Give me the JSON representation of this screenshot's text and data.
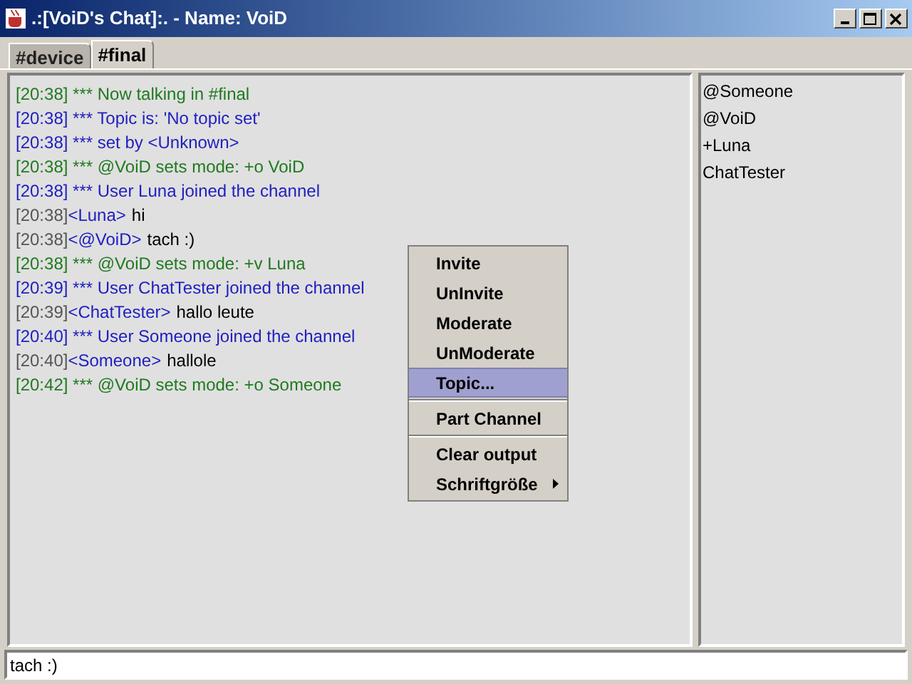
{
  "window": {
    "title": ".:[VoiD's Chat]:. - Name: VoiD"
  },
  "tabs": [
    {
      "label": "#device",
      "selected": false
    },
    {
      "label": "#final",
      "selected": true
    }
  ],
  "chat": {
    "lines": [
      {
        "kind": "status",
        "text": "[20:38] *** Now talking in #final"
      },
      {
        "kind": "info",
        "text": "[20:38] *** Topic is: 'No topic set'"
      },
      {
        "kind": "info",
        "text": "[20:38] *** set by <Unknown>"
      },
      {
        "kind": "status",
        "text": "[20:38] *** @VoiD sets mode: +o VoiD"
      },
      {
        "kind": "info",
        "text": "[20:38] *** User Luna joined the channel"
      },
      {
        "kind": "message",
        "time": "[20:38]",
        "nick": "<Luna>",
        "text": "hi"
      },
      {
        "kind": "message",
        "time": "[20:38]",
        "nick": "<@VoiD>",
        "text": "tach :)"
      },
      {
        "kind": "status",
        "text": "[20:38] *** @VoiD sets mode: +v Luna"
      },
      {
        "kind": "info",
        "text": "[20:39] *** User ChatTester joined the channel"
      },
      {
        "kind": "message",
        "time": "[20:39]",
        "nick": "<ChatTester>",
        "text": "hallo leute"
      },
      {
        "kind": "info",
        "text": "[20:40] *** User Someone joined the channel"
      },
      {
        "kind": "message",
        "time": "[20:40]",
        "nick": "<Someone>",
        "text": "hallole"
      },
      {
        "kind": "status",
        "text": "[20:42] *** @VoiD sets mode: +o Someone"
      }
    ]
  },
  "users": [
    "@Someone",
    "@VoiD",
    "+Luna",
    "ChatTester"
  ],
  "context_menu": {
    "groups": [
      [
        {
          "label": "Invite",
          "selected": false,
          "submenu": false
        },
        {
          "label": "UnInvite",
          "selected": false,
          "submenu": false
        },
        {
          "label": "Moderate",
          "selected": false,
          "submenu": false
        },
        {
          "label": "UnModerate",
          "selected": false,
          "submenu": false
        },
        {
          "label": "Topic...",
          "selected": true,
          "submenu": false
        }
      ],
      [
        {
          "label": "Part Channel",
          "selected": false,
          "submenu": false
        }
      ],
      [
        {
          "label": "Clear output",
          "selected": false,
          "submenu": false
        },
        {
          "label": "Schriftgröße",
          "selected": false,
          "submenu": true
        }
      ]
    ]
  },
  "input": {
    "value": "tach :)"
  }
}
